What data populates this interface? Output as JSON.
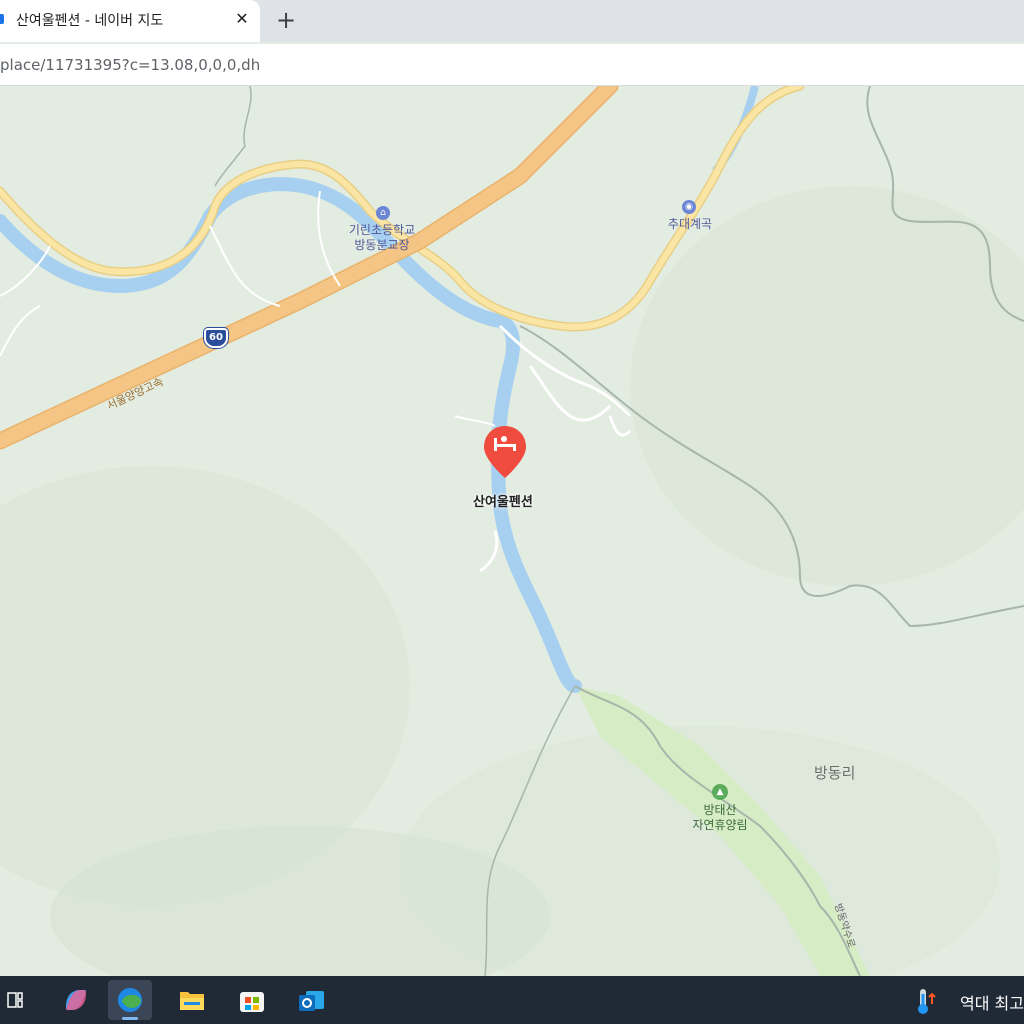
{
  "browser": {
    "tab_title": "산여울펜션 - 네이버 지도",
    "tab_close": "✕",
    "new_tab": "+",
    "url": "place/11731395?c=13.08,0,0,0,dh"
  },
  "map": {
    "selected_place": "산여울펜션",
    "labels": {
      "school_line1": "기린초등학교",
      "school_line2": "방동분교장",
      "valley": "추대계곡",
      "village": "방동리",
      "forest_line1": "방태산",
      "forest_line2": "자연휴양림",
      "expressway": "서울양양고속",
      "expressway_number": "60",
      "local_road": "방동약수로"
    },
    "icons": {
      "place_pin": "lodging-pin-icon",
      "school": "school-icon",
      "valley": "attraction-icon",
      "forest": "forest-icon"
    },
    "colors": {
      "pin": "#ef4b3f",
      "river": "#a7d0f0",
      "expressway": "#f5c585",
      "main_road": "#fbe5a4",
      "land": "#e3ece1",
      "forest_area": "#d4ecc2"
    }
  },
  "taskbar": {
    "apps": [
      "task-view-icon",
      "copilot-icon",
      "edge-icon",
      "file-explorer-icon",
      "store-icon",
      "outlook-icon"
    ],
    "weather_text": "역대 최고"
  }
}
